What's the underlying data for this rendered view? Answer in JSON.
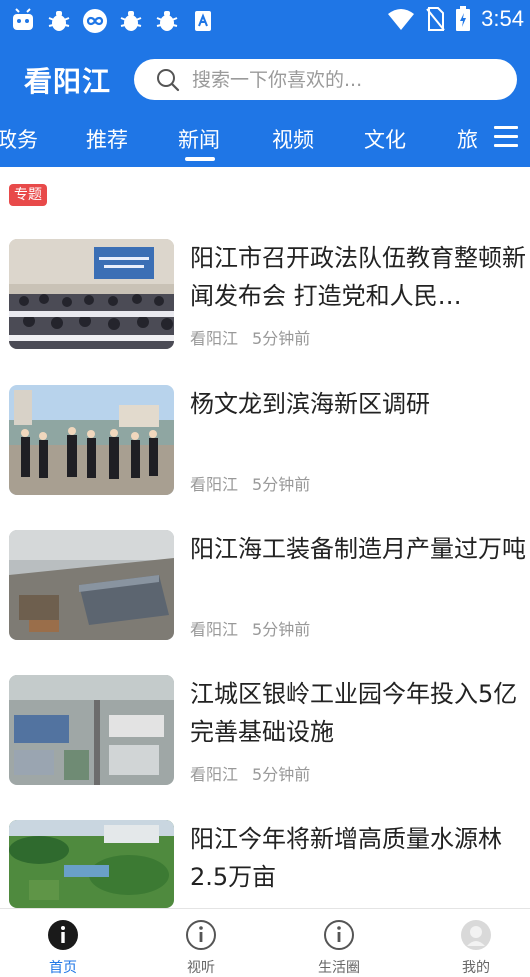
{
  "status_bar": {
    "time": "3:54",
    "icons": [
      "app-notification-icon",
      "bug-icon",
      "infinity-icon",
      "bug-icon",
      "bug-icon",
      "text-icon",
      "wifi-icon",
      "no-sim-icon",
      "battery-icon"
    ]
  },
  "header": {
    "app_title": "看阳江",
    "search_placeholder": "搜索一下你喜欢的...",
    "background_color": "#1f76e6"
  },
  "tabs": [
    {
      "label": "政务"
    },
    {
      "label": "推荐"
    },
    {
      "label": "新闻",
      "active": true
    },
    {
      "label": "视频"
    },
    {
      "label": "文化"
    },
    {
      "label": "旅"
    }
  ],
  "topic_badge": "专题",
  "news": [
    {
      "title": "阳江市召开政法队伍教育整顿新闻发布会 打造党和人民…",
      "source": "看阳江",
      "time": "5分钟前",
      "image": "press-conference-photo"
    },
    {
      "title": "杨文龙到滨海新区调研",
      "source": "看阳江",
      "time": "5分钟前",
      "image": "officials-site-visit-photo"
    },
    {
      "title": "阳江海工装备制造月产量过万吨",
      "source": "看阳江",
      "time": "5分钟前",
      "image": "shipyard-aerial-photo"
    },
    {
      "title": "江城区银岭工业园今年投入5亿完善基础设施",
      "source": "看阳江",
      "time": "5分钟前",
      "image": "industrial-park-aerial-photo"
    },
    {
      "title": "阳江今年将新增高质量水源林2.5万亩",
      "source": "",
      "time": "",
      "image": "forest-park-aerial-photo"
    }
  ],
  "bottom_nav": [
    {
      "label": "首页",
      "icon": "info-icon",
      "active": true
    },
    {
      "label": "视听",
      "icon": "info-outline-icon"
    },
    {
      "label": "生活圈",
      "icon": "info-outline-icon"
    },
    {
      "label": "我的",
      "icon": "user-avatar-icon"
    }
  ],
  "colors": {
    "accent": "#1f76e6",
    "badge": "#e84a4a",
    "meta_text": "#999999"
  }
}
